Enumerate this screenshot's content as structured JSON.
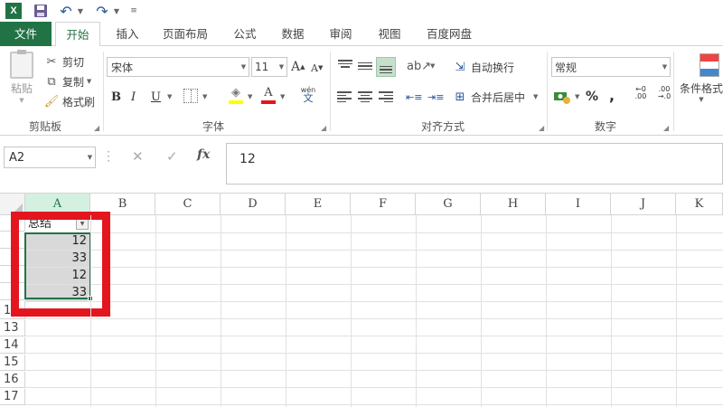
{
  "title_bar": {
    "app_icon": "X",
    "icons": [
      "excel-logo-icon",
      "save-icon",
      "undo-icon",
      "redo-icon",
      "customize-qat-icon"
    ]
  },
  "tabs": [
    "文件",
    "开始",
    "插入",
    "页面布局",
    "公式",
    "数据",
    "审阅",
    "视图",
    "百度网盘"
  ],
  "ribbon": {
    "clipboard": {
      "paste": "粘贴",
      "cut": "剪切",
      "copy": "复制",
      "format_painter": "格式刷",
      "group_label": "剪贴板"
    },
    "font": {
      "font_name": "宋体",
      "font_size": "11",
      "grow": "A",
      "shrink": "A",
      "bold": "B",
      "italic": "I",
      "underline": "U",
      "font_color_glyph": "A",
      "phonetic_top": "wén",
      "phonetic_bottom": "文",
      "group_label": "字体",
      "fill_color": "#ffff00",
      "font_color": "#e3161f"
    },
    "alignment": {
      "wrap_text": "自动换行",
      "merge_center": "合并后居中",
      "group_label": "对齐方式"
    },
    "number": {
      "format": "常规",
      "percent": "%",
      "comma": ",",
      "inc_decimal_top": "←0",
      "inc_decimal_bottom": ".00",
      "dec_decimal_top": ".00",
      "dec_decimal_bottom": "→.0",
      "group_label": "数字"
    },
    "styles": {
      "conditional_formatting": "条件格式"
    }
  },
  "formula_bar": {
    "name_box": "A2",
    "fx": "fx",
    "formula": "12"
  },
  "grid": {
    "columns": [
      "A",
      "B",
      "C",
      "D",
      "E",
      "F",
      "G",
      "H",
      "I",
      "J",
      "K"
    ],
    "selected_column": "A",
    "rows": [
      "12",
      "13",
      "14",
      "15",
      "16",
      "17"
    ],
    "column_a_header": "总结",
    "column_a_values": [
      "12",
      "33",
      "12",
      "33"
    ]
  },
  "colors": {
    "accent": "#217346",
    "highlight_frame": "#e3161f"
  }
}
